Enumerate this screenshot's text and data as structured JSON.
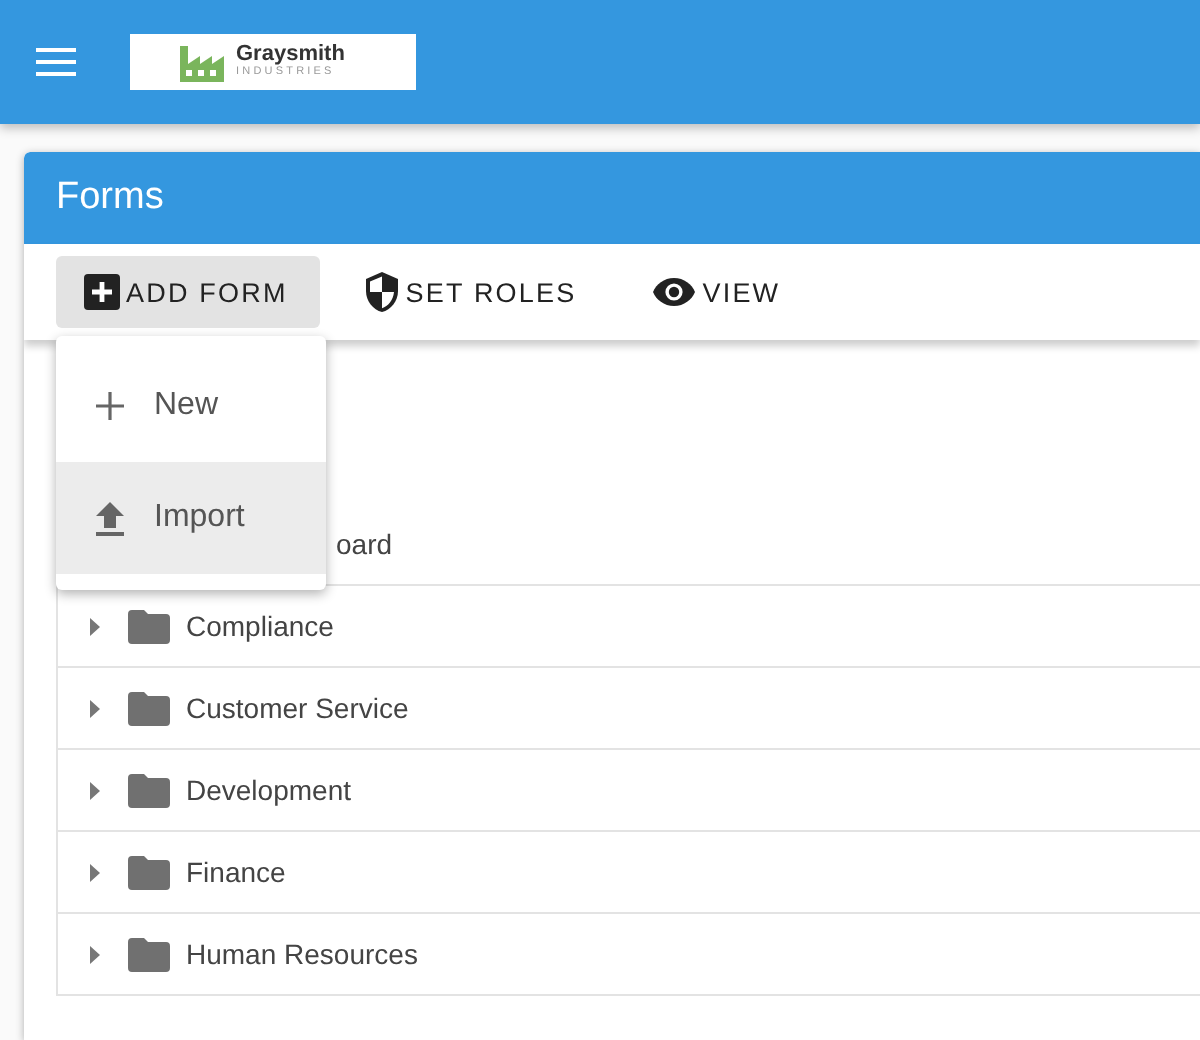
{
  "app_bar": {
    "logo": {
      "name": "Graysmith",
      "tagline": "INDUSTRIES"
    }
  },
  "card": {
    "title": "Forms",
    "toolbar": [
      {
        "label": "ADD FORM",
        "pressed": true
      },
      {
        "label": "SET ROLES",
        "pressed": false
      },
      {
        "label": "VIEW",
        "pressed": false
      }
    ],
    "menu": [
      {
        "label": "New",
        "hovered": false
      },
      {
        "label": "Import",
        "hovered": true
      }
    ],
    "tree": [
      {
        "label": "oard",
        "kind": "covered"
      },
      {
        "label": "Compliance",
        "kind": "folder"
      },
      {
        "label": "Customer Service",
        "kind": "folder"
      },
      {
        "label": "Development",
        "kind": "folder"
      },
      {
        "label": "Finance",
        "kind": "folder"
      },
      {
        "label": "Human Resources",
        "kind": "folder"
      }
    ]
  }
}
